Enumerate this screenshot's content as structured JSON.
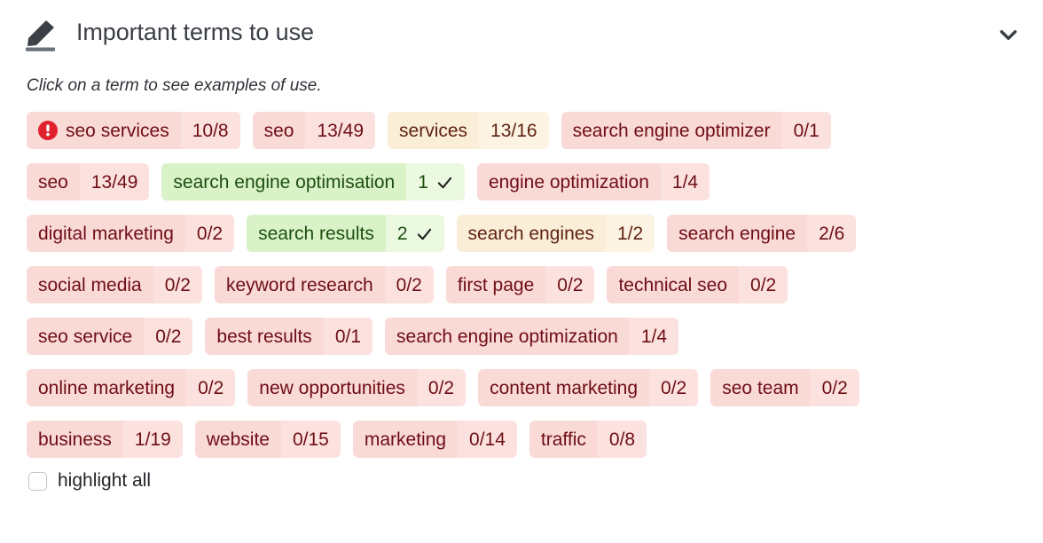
{
  "header": {
    "title": "Important terms to use",
    "icon": "pencil-icon",
    "collapse_icon": "chevron-down-icon"
  },
  "hint": "Click on a term to see examples of use.",
  "footer": {
    "checkbox_label": "highlight all",
    "checked": false
  },
  "colors": {
    "red_label_bg": "#fadad6",
    "red_count_bg": "#fce2de",
    "red_text": "#6e0d16",
    "amber_label_bg": "#fbeed8",
    "amber_count_bg": "#fdf3e3",
    "amber_text": "#5e2312",
    "green_label_bg": "#d9f2c8",
    "green_count_bg": "#eaf9df",
    "green_text": "#1d4f10",
    "warning_icon": "#e0212c",
    "title_text": "#3b3f46"
  },
  "rows": [
    [
      {
        "label": "seo services",
        "count": "10/8",
        "state": "red",
        "warning": true
      },
      {
        "label": "seo",
        "count": "13/49",
        "state": "red"
      },
      {
        "label": "services",
        "count": "13/16",
        "state": "amber"
      },
      {
        "label": "search engine optimizer",
        "count": "0/1",
        "state": "red"
      }
    ],
    [
      {
        "label": "seo",
        "count": "13/49",
        "state": "red"
      },
      {
        "label": "search engine optimisation",
        "count": "1",
        "state": "green",
        "check": true
      },
      {
        "label": "engine optimization",
        "count": "1/4",
        "state": "red"
      }
    ],
    [
      {
        "label": "digital marketing",
        "count": "0/2",
        "state": "red"
      },
      {
        "label": "search results",
        "count": "2",
        "state": "green",
        "check": true
      },
      {
        "label": "search engines",
        "count": "1/2",
        "state": "amber"
      },
      {
        "label": "search engine",
        "count": "2/6",
        "state": "red"
      }
    ],
    [
      {
        "label": "social media",
        "count": "0/2",
        "state": "red"
      },
      {
        "label": "keyword research",
        "count": "0/2",
        "state": "red"
      },
      {
        "label": "first page",
        "count": "0/2",
        "state": "red"
      },
      {
        "label": "technical seo",
        "count": "0/2",
        "state": "red"
      }
    ],
    [
      {
        "label": "seo service",
        "count": "0/2",
        "state": "red"
      },
      {
        "label": "best results",
        "count": "0/1",
        "state": "red"
      },
      {
        "label": "search engine optimization",
        "count": "1/4",
        "state": "red"
      }
    ],
    [
      {
        "label": "online marketing",
        "count": "0/2",
        "state": "red"
      },
      {
        "label": "new opportunities",
        "count": "0/2",
        "state": "red"
      },
      {
        "label": "content marketing",
        "count": "0/2",
        "state": "red"
      },
      {
        "label": "seo team",
        "count": "0/2",
        "state": "red"
      }
    ],
    [
      {
        "label": "business",
        "count": "1/19",
        "state": "red"
      },
      {
        "label": "website",
        "count": "0/15",
        "state": "red"
      },
      {
        "label": "marketing",
        "count": "0/14",
        "state": "red"
      },
      {
        "label": "traffic",
        "count": "0/8",
        "state": "red"
      }
    ]
  ]
}
